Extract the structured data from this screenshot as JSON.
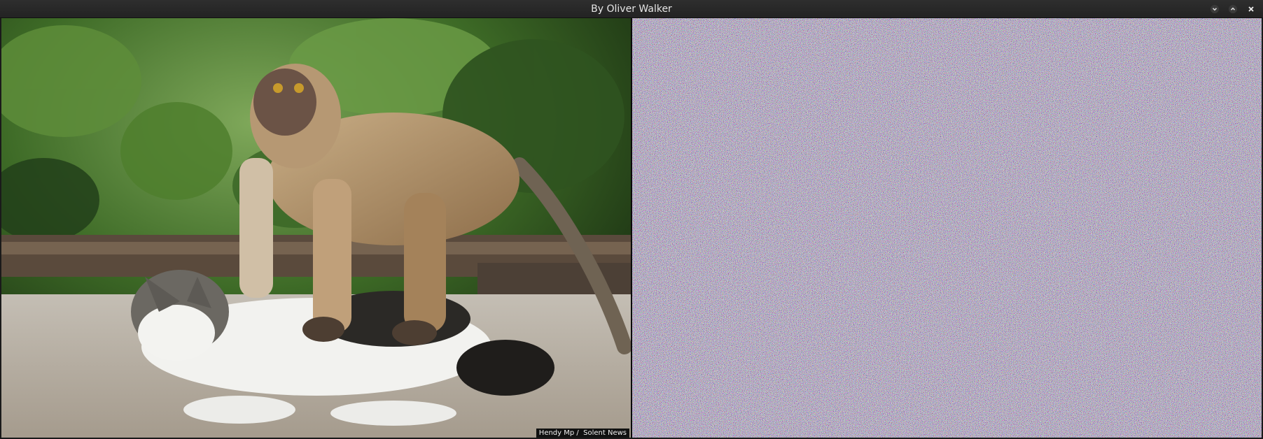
{
  "window": {
    "title": "By Oliver Walker",
    "controls": [
      {
        "name": "minimize",
        "icon": "chevron-down-icon"
      },
      {
        "name": "maximize",
        "icon": "chevron-up-icon"
      },
      {
        "name": "close",
        "icon": "close-icon"
      }
    ]
  },
  "left_image": {
    "description_subjects": [
      "monkey",
      "cat"
    ],
    "credit": "Hendy Mp /  Solent News"
  },
  "right_image": {
    "kind": "noise"
  },
  "colors": {
    "titlebar": "#282828",
    "title_text": "#e6e6e6",
    "foliage": "#3f6a2a",
    "ground": "#b9b2a7"
  }
}
